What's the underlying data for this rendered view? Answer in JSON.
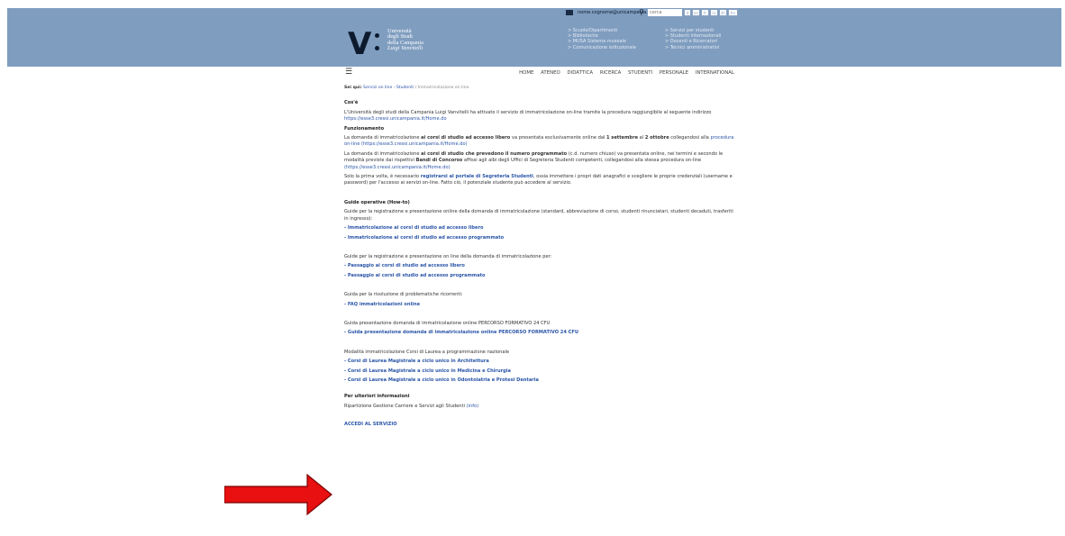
{
  "header": {
    "logo": {
      "mark": "V",
      "lines": [
        "Università",
        "degli Studi",
        "della Campania",
        "Luigi Vanvitelli"
      ]
    },
    "email": "nome.cognome@unicampania.it",
    "search_placeholder": "cerca",
    "languages": [
      "it",
      "en",
      "fr",
      "ru",
      "zh"
    ],
    "zoom_label": "A+",
    "links_left": [
      "> Scuole/Dipartimenti",
      "> Biblioteche",
      "> MUSA Sistema museale",
      "> Comunicazione istituzionale"
    ],
    "links_right": [
      "> Servizi per studenti",
      "> Studenti internazionali",
      "> Docenti e Ricercatori",
      "> Tecnici amministrativi"
    ]
  },
  "nav": {
    "menu_icon": "hamburger-icon",
    "items": [
      "HOME",
      "ATENEO",
      "DIDATTICA",
      "RICERCA",
      "STUDENTI",
      "PERSONALE",
      "INTERNATIONAL"
    ]
  },
  "breadcrumb": {
    "label": "Sei qui:",
    "path": "Servizi on line - Studenti",
    "current": "Immatricolazione on line"
  },
  "content": {
    "cose_title": "Cos'è",
    "cose_text": "L'Università degli studi della Campania Luigi Vanvitelli ha attivato il servizio di immatricolazione on-line tramite la procedura raggiungibile al seguente indirizzo",
    "cose_link": "https://esse3.cressi.unicampania.it/Home.do",
    "funz_title": "Funzionamento",
    "funz_p1_a": "La domanda di immatricolazione",
    "funz_p1_b": "ai corsi di studio ad accesso libero",
    "funz_p1_c": "va presentata esclusivamente online dal",
    "funz_p1_d": "1 settembre",
    "funz_p1_e": "al",
    "funz_p1_f": "2 ottobre",
    "funz_p1_g": "collegandosi alla",
    "funz_p1_link": "procedura on-line (https://esse3.cressi.unicampania.it/Home.do)",
    "funz_p2_a": "La domanda di immatricolazione",
    "funz_p2_b": "ai corsi di studio che prevedono il numero programmato",
    "funz_p2_c": "(c.d. numero chiuso) va presentata online, nei termini e secondo le modalità previste dai rispettivi",
    "funz_p2_d": "Bandi di Concorso",
    "funz_p2_e": "affissi agli albi degli Uffici di Segreteria Studenti competenti, collegandosi alla stessa procedura on-line",
    "funz_p2_link": "(https://esse3.cressi.unicampania.it/Home.do)",
    "funz_p3_a": "Solo la prima volta, è necessario",
    "funz_p3_link": "registrarsi al portale di Segreteria Studenti",
    "funz_p3_b": ", ossia immettere i propri dati anagrafici e scegliere le proprie credenziali (username e password) per l'accesso ai servizi on-line. Fatto ciò, il potenziale studente può accedere al servizio.",
    "guide_title": "Guide operative (How-to)",
    "guide_intro": "Guide per la registrazione e presentazione online della domanda di immatricolazione (standard, abbreviazione di corso, studenti rinunciatari, studenti decaduti, trasferiti in ingresso):",
    "guide_links": [
      "- Immatricolazione ai corsi di studio ad accesso libero",
      "- Immatricolazione ai corsi di studio ad accesso programmato"
    ],
    "pass_intro": "Guide per la registrazione e presentazione on line della domanda di immatricolazione per:",
    "pass_links": [
      "- Passaggio ai corsi di studio ad accesso libero",
      "- Passaggio ai corsi di studio ad accesso programmato"
    ],
    "faq_intro": "Guida per la risoluzione di problematiche ricorrenti:",
    "faq_link": "-  FAQ immatricolazioni online",
    "pf_intro": "Guida presentazione domanda di immatricolazione online PERCORSO FORMATIVO 24 CFU",
    "pf_link": "-  Guida presentazione domanda di immatricolazione online PERCORSO FORMATIVO 24 CFU",
    "naz_intro": "Modalità immatricolazione Corsi di Laurea a programmazione nazionale",
    "naz_links": [
      "-  Corsi di Laurea Magistrale a ciclo unico in Architettura",
      "-  Corsi di Laurea Magistrale a ciclo unico in Medicina e Chirurgia",
      "-  Corsi di Laurea Magistrale a ciclo unico in Odontoiatria e Protesi Dentaria"
    ],
    "info_title": "Per ulteriori informazioni",
    "info_text": "Ripartizione Gestione Carriere e Servizi agli Studenti",
    "info_link": "(info)",
    "access_link": "ACCEDI AL SERVIZIO"
  },
  "annotation": {
    "arrow_color": "#e81010",
    "arrow_icon": "right-arrow-icon"
  }
}
